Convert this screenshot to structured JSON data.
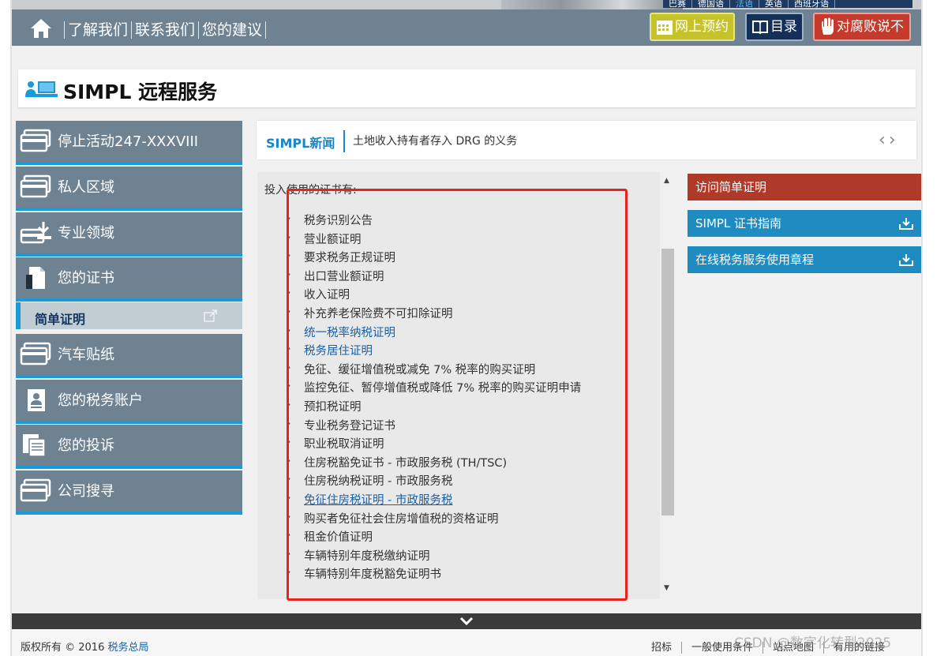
{
  "topbar": {
    "languages": [
      "巴赛",
      "德国语",
      "法语",
      "英语",
      "西班牙语"
    ],
    "active_language": "法语"
  },
  "nav": {
    "links": [
      "了解我们",
      "联系我们",
      "您的建议"
    ],
    "appointment_label": "网上预约",
    "directory_label": "目录",
    "corruption_label": "对腐败说不"
  },
  "page": {
    "title": "SIMPL 远程服务"
  },
  "sidebar": {
    "items": [
      {
        "label": "停止活动247-XXXVIII",
        "icon": "card-icon"
      },
      {
        "label": "私人区域",
        "icon": "card-icon"
      },
      {
        "label": "专业领域",
        "icon": "download-tray-icon"
      },
      {
        "label": "您的证书",
        "icon": "document-icon"
      },
      {
        "label": "汽车贴纸",
        "icon": "card-icon"
      },
      {
        "label": "您的税务账户",
        "icon": "id-card-icon"
      },
      {
        "label": "您的投诉",
        "icon": "papers-icon"
      },
      {
        "label": "公司搜寻",
        "icon": "card-icon"
      }
    ],
    "subitem": {
      "label": "简单证明",
      "icon": "external-link-icon"
    }
  },
  "news": {
    "title": "SIMPL新闻",
    "headline": "土地收入持有者存入 DRG 的义务"
  },
  "content": {
    "intro": "投入使用的证书有:",
    "items": [
      {
        "text": "税务识别公告",
        "type": "text"
      },
      {
        "text": "营业额证明",
        "type": "text"
      },
      {
        "text": "要求税务正规证明",
        "type": "text"
      },
      {
        "text": "出口营业额证明",
        "type": "text"
      },
      {
        "text": "收入证明",
        "type": "text"
      },
      {
        "text": "补充养老保险费不可扣除证明",
        "type": "text"
      },
      {
        "text": "统一税率纳税证明",
        "type": "link"
      },
      {
        "text": "税务居住证明",
        "type": "link"
      },
      {
        "text": "免征、缓征增值税或减免 7% 税率的购买证明",
        "type": "text"
      },
      {
        "text": "监控免征、暂停增值税或降低 7% 税率的购买证明申请",
        "type": "text"
      },
      {
        "text": "预扣税证明",
        "type": "text"
      },
      {
        "text": "专业税务登记证书",
        "type": "text"
      },
      {
        "text": "职业税取消证明",
        "type": "text"
      },
      {
        "text": "住房税豁免证书 - 市政服务税 (TH/TSC)",
        "type": "text"
      },
      {
        "text": "住房税纳税证明 - 市政服务税",
        "type": "text"
      },
      {
        "text": "免征住房税证明 - 市政服务税",
        "type": "link-underline"
      },
      {
        "text": "购买者免征社会住房增值税的资格证明",
        "type": "text"
      },
      {
        "text": "租金价值证明",
        "type": "text"
      },
      {
        "text": "车辆特别年度税缴纳证明",
        "type": "text"
      },
      {
        "text": "车辆特别年度税豁免证明书",
        "type": "text"
      }
    ]
  },
  "right_menu": [
    {
      "label": "访问简单证明",
      "color": "#b03a2a"
    },
    {
      "label": "SIMPL 证书指南",
      "color": "#1e8cc1"
    },
    {
      "label": "在线税务服务使用章程",
      "color": "#1e8cc1"
    }
  ],
  "footer": {
    "copyright": "版权所有 © 2016",
    "org": "税务总局",
    "links": [
      "招标",
      "一般使用条件",
      "站点地图",
      "有用的链接"
    ]
  },
  "watermark": "CSDN @数字化转型2025"
}
